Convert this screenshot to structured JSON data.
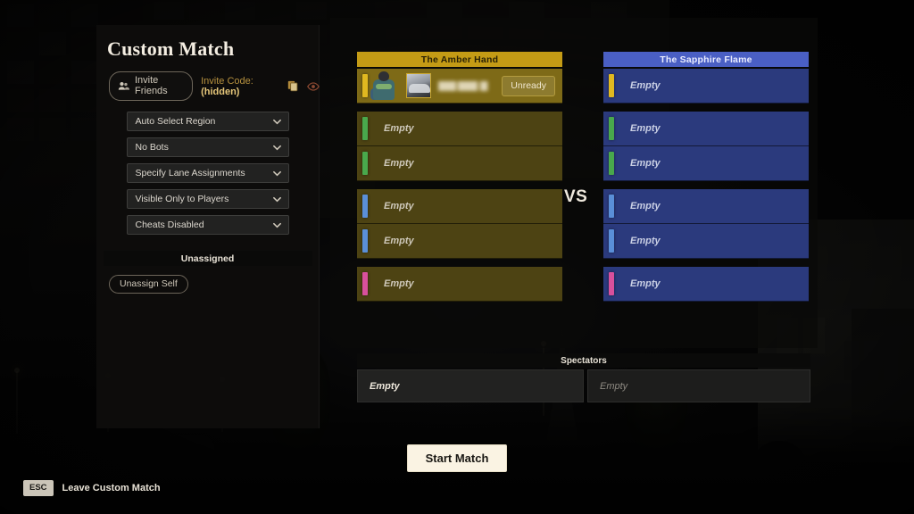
{
  "sidebar": {
    "title": "Custom Match",
    "invite_friends_label": "Invite Friends",
    "invite_friends_icon": "people-icon",
    "invite_code_label": "Invite Code:",
    "invite_code_value": "(hidden)",
    "copy_icon": "copy-icon",
    "reveal_icon": "eye-icon",
    "dropdowns": [
      {
        "value": "Auto Select Region",
        "name": "region-dropdown"
      },
      {
        "value": "No Bots",
        "name": "bots-dropdown"
      },
      {
        "value": "Specify Lane Assignments",
        "name": "lane-assignment-dropdown"
      },
      {
        "value": "Visible Only to Players",
        "name": "visibility-dropdown"
      },
      {
        "value": "Cheats Disabled",
        "name": "cheats-dropdown"
      }
    ],
    "unassigned_header": "Unassigned",
    "unassign_self_label": "Unassign Self"
  },
  "match": {
    "vs_label": "VS",
    "empty_label": "Empty",
    "teams": [
      {
        "name": "The Amber Hand",
        "side": "amber",
        "accent": "#c49b15",
        "slots": [
          {
            "state": "occupied",
            "lane_color": "#e0b820",
            "ready_label": "Unready",
            "player_name_hidden": true
          },
          {
            "state": "empty",
            "lane_color": "#49a84c",
            "label": "Empty"
          },
          {
            "state": "empty",
            "lane_color": "#49a84c",
            "label": "Empty"
          },
          {
            "state": "empty",
            "lane_color": "#5a8fd8",
            "label": "Empty"
          },
          {
            "state": "empty",
            "lane_color": "#5a8fd8",
            "label": "Empty"
          },
          {
            "state": "empty",
            "lane_color": "#d8509c",
            "label": "Empty"
          }
        ]
      },
      {
        "name": "The Sapphire Flame",
        "side": "sapphire",
        "accent": "#4a5fc4",
        "slots": [
          {
            "state": "empty",
            "lane_color": "#e0b820",
            "label": "Empty"
          },
          {
            "state": "empty",
            "lane_color": "#49a84c",
            "label": "Empty"
          },
          {
            "state": "empty",
            "lane_color": "#49a84c",
            "label": "Empty"
          },
          {
            "state": "empty",
            "lane_color": "#5a8fd8",
            "label": "Empty"
          },
          {
            "state": "empty",
            "lane_color": "#5a8fd8",
            "label": "Empty"
          },
          {
            "state": "empty",
            "lane_color": "#d8509c",
            "label": "Empty"
          }
        ]
      }
    ]
  },
  "spectators": {
    "header": "Spectators",
    "slots": [
      {
        "label": "Empty",
        "active": true
      },
      {
        "label": "Empty",
        "active": false
      }
    ]
  },
  "start_match_label": "Start Match",
  "footer": {
    "key": "ESC",
    "label": "Leave Custom Match"
  },
  "colors": {
    "amber_accent": "#c49b15",
    "sapphire_accent": "#4a5fc4",
    "start_button": "#faf3e3",
    "invite_code_text": "#b6913f"
  }
}
